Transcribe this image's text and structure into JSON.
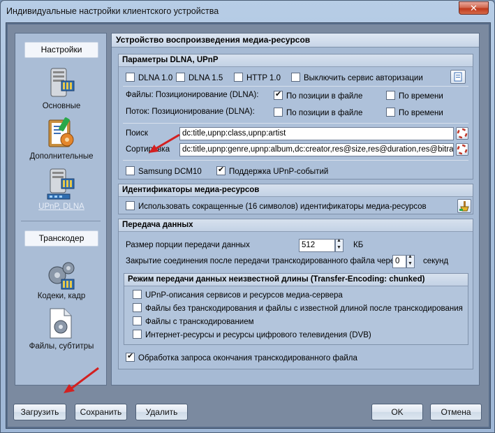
{
  "window": {
    "title": "Индивидуальные настройки клиентского устройства",
    "close_glyph": "✕"
  },
  "nav": {
    "settings_header": "Настройки",
    "items": [
      {
        "label": "Основные",
        "icon": "server-icon"
      },
      {
        "label": "Дополнительные",
        "icon": "clipboard-tools-icon"
      },
      {
        "label": "UPnP, DLNA",
        "icon": "network-server-icon",
        "active": true
      }
    ],
    "transcoder_header": "Транскодер",
    "transcoder_items": [
      {
        "label": "Кодеки, кадр",
        "icon": "gears-icon"
      },
      {
        "label": "Файлы, субтитры",
        "icon": "file-gear-icon"
      }
    ]
  },
  "main": {
    "title": "Устройство воспроизведения медиа-ресурсов",
    "dlna": {
      "header": "Параметры DLNA, UPnP",
      "dlna10": "DLNA 1.0",
      "dlna15": "DLNA 1.5",
      "http10": "HTTP 1.0",
      "disable_auth": "Выключить сервис авторизации",
      "files_pos_label": "Файлы: Позиционирование (DLNA):",
      "stream_pos_label": "Поток: Позиционирование (DLNA):",
      "by_file_pos": "По позиции в файле",
      "by_time": "По времени",
      "search_label": "Поиск",
      "search_value": "dc:title,upnp:class,upnp:artist",
      "sort_label": "Сортировка",
      "sort_value": "dc:title,upnp:genre,upnp:album,dc:creator,res@size,res@duration,res@bitrate,dc",
      "samsung": "Samsung DCM10",
      "upnp_events": "Поддержка UPnP-событий"
    },
    "ids": {
      "header": "Идентификаторы медиа-ресурсов",
      "short_ids": "Использовать сокращенные (16 символов) идентификаторы медиа-ресурсов"
    },
    "transfer": {
      "header": "Передача данных",
      "chunk_label": "Размер порции передачи данных",
      "chunk_value": "512",
      "chunk_unit": "КБ",
      "close_label": "Закрытие соединения после передачи транскодированного файла через",
      "close_value": "0",
      "close_unit": "секунд",
      "unknown_header": "Режим передачи данных неизвестной длины (Transfer-Encoding: chunked)",
      "opt1": "UPnP-описания сервисов и ресурсов медиа-сервера",
      "opt2": "Файлы без транскодирования и файлы с известной длиной после транскодирования",
      "opt3": "Файлы с транскодированием",
      "opt4": "Интернет-ресурсы и ресурсы цифрового телевидения (DVB)",
      "end_request": "Обработка запроса окончания транскодированного файла"
    }
  },
  "buttons": {
    "load": "Загрузить",
    "save": "Сохранить",
    "delete": "Удалить",
    "ok": "OK",
    "cancel": "Отмена"
  }
}
